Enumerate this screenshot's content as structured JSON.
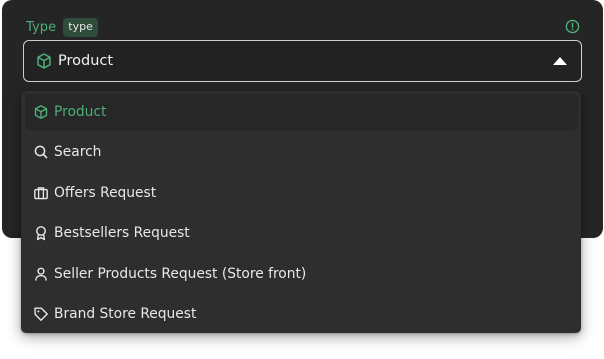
{
  "field": {
    "label": "Type",
    "badge": "type",
    "info_icon": "info-circle-icon",
    "accent_color": "#4caf79"
  },
  "select": {
    "value": "Product",
    "icon": "cube-icon",
    "expanded": true
  },
  "options": [
    {
      "label": "Product",
      "icon": "cube-icon",
      "selected": true
    },
    {
      "label": "Search",
      "icon": "search-icon",
      "selected": false
    },
    {
      "label": "Offers Request",
      "icon": "briefcase-icon",
      "selected": false
    },
    {
      "label": "Bestsellers Request",
      "icon": "award-ribbon-icon",
      "selected": false
    },
    {
      "label": "Seller Products Request (Store front)",
      "icon": "user-icon",
      "selected": false
    },
    {
      "label": "Brand Store Request",
      "icon": "tag-icon",
      "selected": false
    }
  ]
}
